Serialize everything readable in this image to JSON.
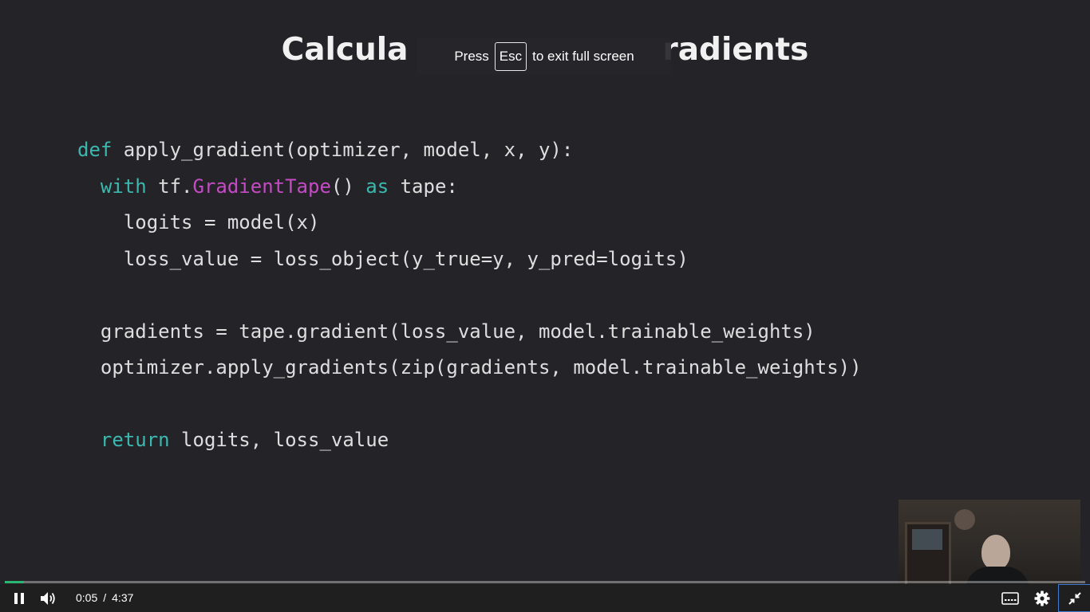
{
  "slide": {
    "title_left": "Calcula",
    "title_right": "radients"
  },
  "fullscreen_notice": {
    "prefix": "Press",
    "key": "Esc",
    "suffix": "to exit full screen"
  },
  "code": {
    "lines": [
      [
        {
          "t": "def",
          "c": "kw"
        },
        {
          "t": " apply_gradient(optimizer, model, x, y):",
          "c": ""
        }
      ],
      [
        {
          "t": "  ",
          "c": ""
        },
        {
          "t": "with",
          "c": "kw"
        },
        {
          "t": " tf.",
          "c": ""
        },
        {
          "t": "GradientTape",
          "c": "cls"
        },
        {
          "t": "() ",
          "c": ""
        },
        {
          "t": "as",
          "c": "kw"
        },
        {
          "t": " tape:",
          "c": ""
        }
      ],
      [
        {
          "t": "    logits = model(x)",
          "c": ""
        }
      ],
      [
        {
          "t": "    loss_value = loss_object(y_true=y, y_pred=logits)",
          "c": ""
        }
      ],
      [
        {
          "t": "",
          "c": ""
        }
      ],
      [
        {
          "t": "  gradients = tape.gradient(loss_value, model.trainable_weights)",
          "c": ""
        }
      ],
      [
        {
          "t": "  optimizer.apply_gradients(zip(gradients, model.trainable_weights))",
          "c": ""
        }
      ],
      [
        {
          "t": "",
          "c": ""
        }
      ],
      [
        {
          "t": "  ",
          "c": ""
        },
        {
          "t": "return",
          "c": "kw"
        },
        {
          "t": " logits, loss_value",
          "c": ""
        }
      ]
    ]
  },
  "player": {
    "current_time": "0:05",
    "separator": "/",
    "duration": "4:37",
    "progress": 0.018,
    "accent_color": "#2bb673",
    "icons": {
      "play_pause": "pause-icon",
      "volume": "volume-icon",
      "captions": "captions-icon",
      "settings": "gear-icon",
      "exit_fullscreen": "exit-fullscreen-icon"
    }
  },
  "colors": {
    "background": "#242327",
    "keyword": "#3bb9b0",
    "class_name": "#c54bc5",
    "code_text": "#dedede"
  }
}
